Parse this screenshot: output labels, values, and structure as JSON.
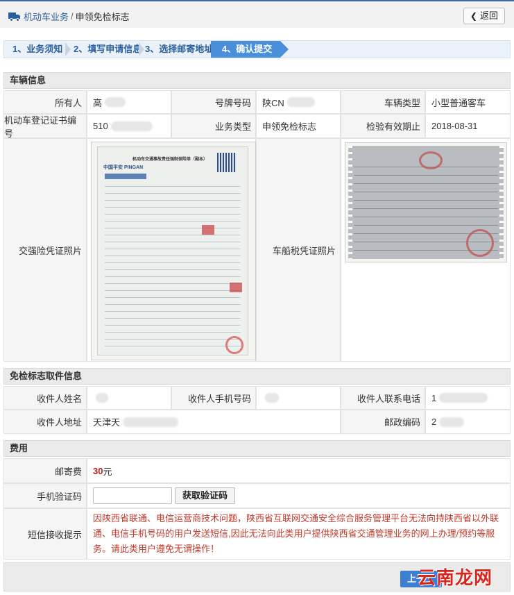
{
  "header": {
    "breadcrumb_parent": "机动车业务",
    "breadcrumb_sep": "/",
    "breadcrumb_current": "申领免检标志",
    "back_label": "返回"
  },
  "steps": [
    {
      "label": "1、业务须知"
    },
    {
      "label": "2、填写申请信息"
    },
    {
      "label": "3、选择邮寄地址"
    },
    {
      "label": "4、确认提交"
    }
  ],
  "vehicle": {
    "title": "车辆信息",
    "owner_label": "所有人",
    "owner_value": "高",
    "plate_label": "号牌号码",
    "plate_value": "陕CN",
    "type_label": "车辆类型",
    "type_value": "小型普通客车",
    "reg_label": "机动车登记证书编号",
    "reg_value": "510",
    "biz_label": "业务类型",
    "biz_value": "申领免检标志",
    "expire_label": "检验有效期止",
    "expire_value": "2018-08-31",
    "insurance_label": "交强险凭证照片",
    "insurance_doc": {
      "brand": "中国平安 PINGAN",
      "title": "机动车交通事故责任强制保险单（副本）"
    },
    "tax_label": "车船税凭证照片"
  },
  "delivery": {
    "title": "免检标志取件信息",
    "name_label": "收件人姓名",
    "phone_label": "收件人手机号码",
    "contact_label": "收件人联系电话",
    "contact_value": "1",
    "address_label": "收件人地址",
    "address_value": "天津天",
    "zip_label": "邮政编码",
    "zip_value": "2"
  },
  "fee": {
    "title": "费用",
    "postage_label": "邮寄费",
    "postage_amount": "30",
    "postage_unit": "元",
    "code_label": "手机验证码",
    "code_placeholder": "",
    "code_button": "获取验证码",
    "sms_label": "短信接收提示",
    "sms_text": "因陕西省联通、电信运营商技术问题，陕西省互联网交通安全综合服务管理平台无法向持陕西省以外联通、电信手机号码的用户发送短信,因此无法向此类用户提供陕西省交通管理业务的网上办理/预约等服务。请此类用户遵免无谓操作！"
  },
  "footer": {
    "prev_label": "上一"
  },
  "watermark": {
    "text": "云南龙网"
  },
  "colors": {
    "accent": "#4a8fd9",
    "price": "#b22222",
    "notice": "#c0392b"
  }
}
